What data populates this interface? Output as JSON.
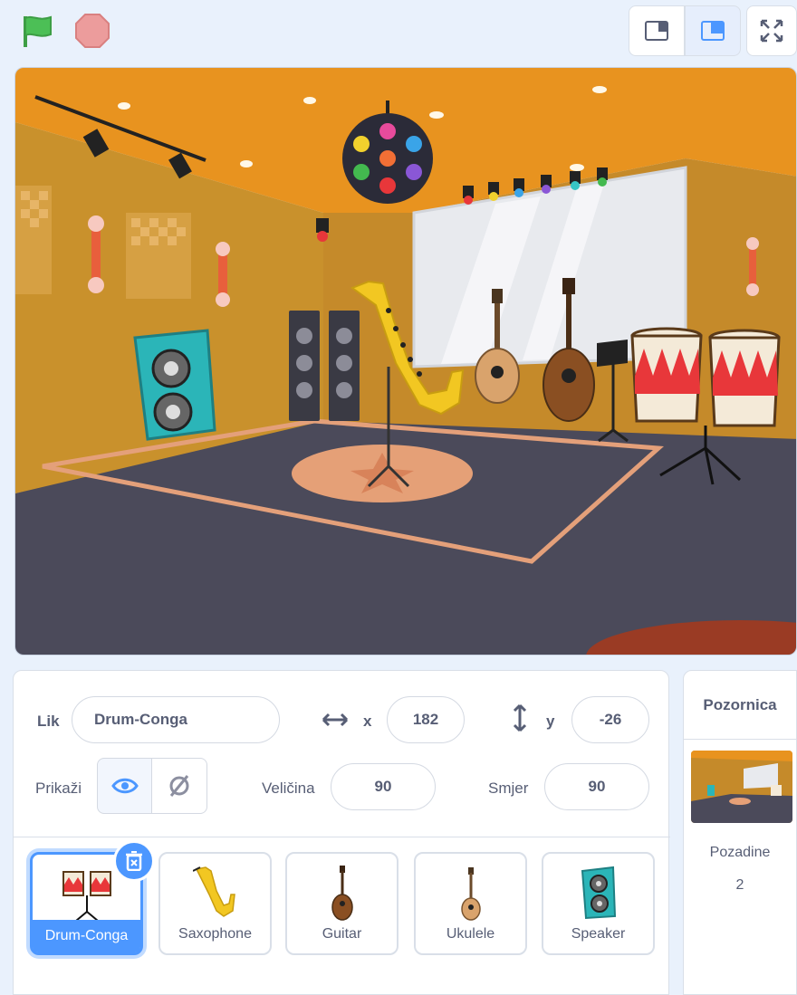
{
  "toolbar": {
    "flag_icon": "green-flag-icon",
    "stop_icon": "stop-icon",
    "view_buttons": [
      "small-stage-icon",
      "normal-stage-icon",
      "fullscreen-icon"
    ]
  },
  "sprite_info": {
    "sprite_label": "Lik",
    "sprite_name": "Drum-Conga",
    "x_label": "x",
    "x_value": "182",
    "y_label": "y",
    "y_value": "-26",
    "show_label": "Prikaži",
    "size_label": "Veličina",
    "size_value": "90",
    "direction_label": "Smjer",
    "direction_value": "90"
  },
  "sprites": [
    {
      "name": "Drum-Conga",
      "selected": true,
      "icon": "conga-icon"
    },
    {
      "name": "Saxophone",
      "selected": false,
      "icon": "saxophone-icon"
    },
    {
      "name": "Guitar",
      "selected": false,
      "icon": "guitar-icon"
    },
    {
      "name": "Ukulele",
      "selected": false,
      "icon": "ukulele-icon"
    },
    {
      "name": "Speaker",
      "selected": false,
      "icon": "speaker-icon"
    }
  ],
  "stage_panel": {
    "title": "Pozornica",
    "backdrops_label": "Pozadine",
    "backdrops_count": "2"
  },
  "colors": {
    "accent": "#4c97ff",
    "flag": "#4cbf56",
    "stop": "#ec9c9c"
  }
}
